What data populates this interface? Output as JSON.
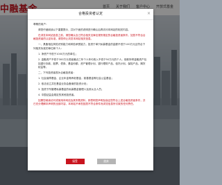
{
  "header": {
    "logo_text": "中融基金",
    "nav": [
      "首页",
      "关于我们",
      "客户中心",
      "开放式基金"
    ]
  },
  "modal": {
    "title": "合格投资者认定",
    "close_symbol": "×",
    "greeting": "尊敬的用户：",
    "intro": "请您仔细阅读以下重要提示，并对下面的说明进行确认后再访问本网站的相关内容。",
    "highlight": "在浏览本网站信息之前，请您确认自己符合相关法律法规所规定的合格投资者条件，如您不符合合格投资者的认定标准，请您停止浏览本网站相关信息。",
    "criteria_heading": "一、具备相应风险识别能力和风险承受能力，投资于单只私募基金的金额不低于100万元且符合下列相关标准的单位和个人：",
    "criteria_items": [
      "1. 净资产不低于1000万元的单位；",
      "2. 金融资产不低于300万元或者最近三年个人年均收入不低于50万元的个人。前款所称金融资产包括银行存款、股票、债券、基金份额、资产管理计划、银行理财产品、信托计划、保险产品、期货权益等。"
    ],
    "others_heading": "二、下列投资者视为合格投资者：",
    "others_items": [
      "1. 社会保障基金、企业年金等养老基金，慈善基金等社会公益基金；",
      "2. 依法设立并在基金业协会备案的投资计划；",
      "3. 投资于所管理私募基金的私募基金管理人及其从业人员；",
      "4. 中国证监会规定的其他投资者。"
    ],
    "closing": "如果您继续访问或使用本网站及其所载资料，即表明您声明及保证您符合上述合格投资者条件，并已充分理解本声明的全部内容，本网站不承担因您不符合条件而浏览信息所引致的任何责任。",
    "accept_label": "接受",
    "reject_label": "放弃"
  }
}
